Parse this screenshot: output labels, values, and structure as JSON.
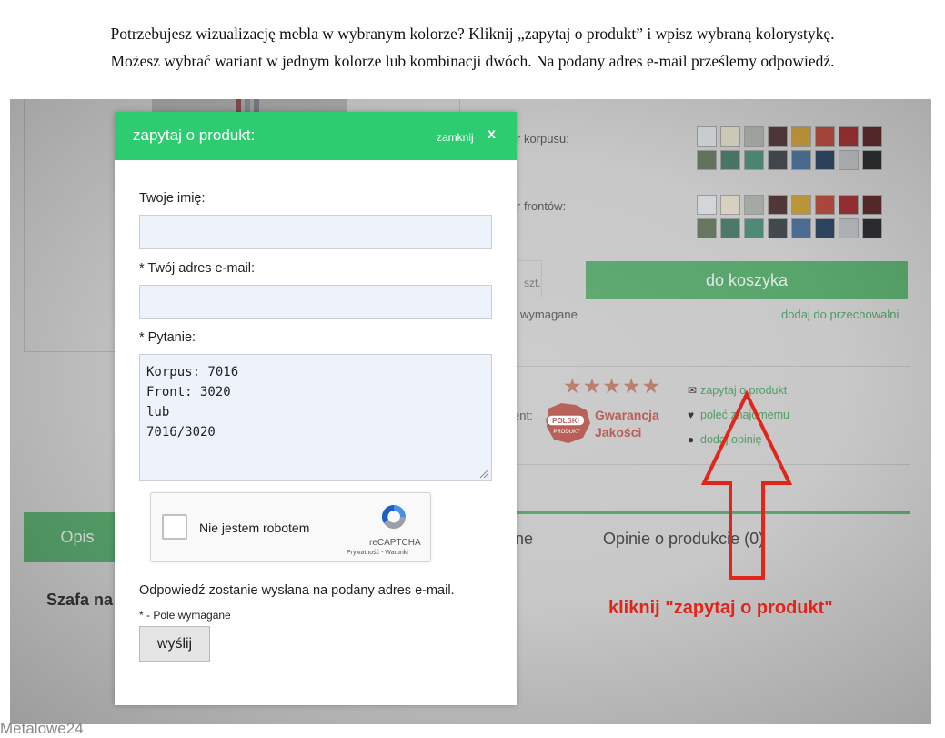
{
  "intro": {
    "line1": "Potrzebujesz wizualizację mebla w wybranym kolorze? Kliknij „zapytaj o produkt” i wpisz wybraną kolorystykę.",
    "line2": "Możesz wybrać wariant w jednym kolorze lub kombinacji dwóch. Na podany adres e-mail prześlemy odpowiedź."
  },
  "background_page": {
    "korpus_label": "r korpusu:",
    "fronty_label": "r frontów:",
    "swatch_colors_row1": [
      "#d2d6d8",
      "#d8d2c0",
      "#a8aca6",
      "#53383a",
      "#c29a3b",
      "#b04a3e",
      "#9a3134",
      "#5a2a2c"
    ],
    "swatch_colors_row2": [
      "#667560",
      "#4c7868",
      "#4f8a78",
      "#434a4f",
      "#4c6f97",
      "#2e4560",
      "#b4b7b9",
      "#2c2d2e"
    ],
    "qty_unit": "szt.",
    "cart_button": "do koszyka",
    "required_note": "wymagane",
    "store_link": "dodaj do przechowalni",
    "stars": "★★★★★",
    "ent_label": "ent:",
    "badge_top": "POLSKI",
    "badge_bottom": "PRODUKT",
    "badge_line1": "Gwarancja",
    "badge_line2": "Jakości",
    "action_ask": "zapytaj o produkt",
    "action_recommend": "poleć znajomemu",
    "action_review": "dodaj opinię",
    "tab_opis": "Opis",
    "tab_partial": "ne",
    "tab_opinie": "Opinie o produkcie (0)",
    "heading_partial": "Szafa na"
  },
  "annotation": {
    "text": "kliknij \"zapytaj o produkt\"",
    "color": "#e0251b"
  },
  "modal": {
    "title": "zapytaj o produkt:",
    "close_label": "zamknij",
    "close_x": "x",
    "accent": "#2ecc71",
    "name_label": "Twoje imię:",
    "name_value": "",
    "email_label": "* Twój adres e-mail:",
    "email_value": "",
    "question_label": "* Pytanie:",
    "question_value": "Korpus: 7016\nFront: 3020\nlub\n7016/3020",
    "captcha_label": "Nie jestem robotem",
    "captcha_brand": "reCAPTCHA",
    "captcha_links": "Prywatność - Warunki",
    "answer_note": "Odpowiedź zostanie wysłana na podany adres e-mail.",
    "required_note": "* - Pole wymagane",
    "send_button": "wyślij"
  },
  "watermark": "Metalowe24"
}
